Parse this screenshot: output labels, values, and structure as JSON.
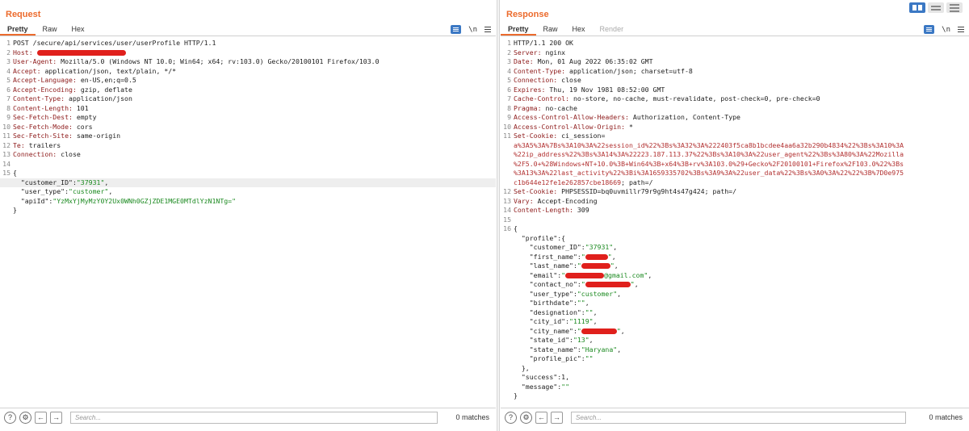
{
  "request": {
    "title": "Request",
    "tabs": [
      "Pretty",
      "Raw",
      "Hex"
    ],
    "newline_toggle": "\\n",
    "search_placeholder": "Search...",
    "matches": "0 matches",
    "lines": [
      {
        "n": "1",
        "parts": [
          {
            "c": "v",
            "t": "POST /secure/api/services/user/userProfile HTTP/1.1"
          }
        ]
      },
      {
        "n": "2",
        "parts": [
          {
            "c": "k",
            "t": "Host: "
          },
          {
            "redact": 110
          }
        ]
      },
      {
        "n": "3",
        "parts": [
          {
            "c": "k",
            "t": "User-Agent: "
          },
          {
            "c": "v",
            "t": "Mozilla/5.0 (Windows NT 10.0; Win64; x64; rv:103.0) Gecko/20100101 Firefox/103.0"
          }
        ]
      },
      {
        "n": "4",
        "parts": [
          {
            "c": "k",
            "t": "Accept: "
          },
          {
            "c": "v",
            "t": "application/json, text/plain, */*"
          }
        ]
      },
      {
        "n": "5",
        "parts": [
          {
            "c": "k",
            "t": "Accept-Language: "
          },
          {
            "c": "v",
            "t": "en-US,en;q=0.5"
          }
        ]
      },
      {
        "n": "6",
        "parts": [
          {
            "c": "k",
            "t": "Accept-Encoding: "
          },
          {
            "c": "v",
            "t": "gzip, deflate"
          }
        ]
      },
      {
        "n": "7",
        "parts": [
          {
            "c": "k",
            "t": "Content-Type: "
          },
          {
            "c": "v",
            "t": "application/json"
          }
        ]
      },
      {
        "n": "8",
        "parts": [
          {
            "c": "k",
            "t": "Content-Length: "
          },
          {
            "c": "v",
            "t": "101"
          }
        ]
      },
      {
        "n": "9",
        "parts": [
          {
            "c": "k",
            "t": "Sec-Fetch-Dest: "
          },
          {
            "c": "v",
            "t": "empty"
          }
        ]
      },
      {
        "n": "10",
        "parts": [
          {
            "c": "k",
            "t": "Sec-Fetch-Mode: "
          },
          {
            "c": "v",
            "t": "cors"
          }
        ]
      },
      {
        "n": "11",
        "parts": [
          {
            "c": "k",
            "t": "Sec-Fetch-Site: "
          },
          {
            "c": "v",
            "t": "same-origin"
          }
        ]
      },
      {
        "n": "12",
        "parts": [
          {
            "c": "k",
            "t": "Te: "
          },
          {
            "c": "v",
            "t": "trailers"
          }
        ]
      },
      {
        "n": "13",
        "parts": [
          {
            "c": "k",
            "t": "Connection: "
          },
          {
            "c": "v",
            "t": "close"
          }
        ]
      },
      {
        "n": "14",
        "parts": []
      },
      {
        "n": "15",
        "parts": [
          {
            "c": "v",
            "t": "{"
          }
        ]
      },
      {
        "n": "",
        "hl": true,
        "parts": [
          {
            "c": "jk",
            "t": "  \"customer_ID\":"
          },
          {
            "c": "js",
            "t": "\"37931\""
          },
          {
            "c": "v",
            "t": ","
          }
        ]
      },
      {
        "n": "",
        "parts": [
          {
            "c": "jk",
            "t": "  \"user_type\":"
          },
          {
            "c": "js",
            "t": "\"customer\""
          },
          {
            "c": "v",
            "t": ","
          }
        ]
      },
      {
        "n": "",
        "parts": [
          {
            "c": "jk",
            "t": "  \"apiId\":"
          },
          {
            "c": "js",
            "t": "\"YzMxYjMyMzY0Y2Ux0WNh0GZjZDE1MGE0MTdlYzN1NTg=\""
          }
        ]
      },
      {
        "n": "",
        "parts": [
          {
            "c": "v",
            "t": "}"
          }
        ]
      }
    ]
  },
  "response": {
    "title": "Response",
    "tabs": [
      "Pretty",
      "Raw",
      "Hex",
      "Render"
    ],
    "newline_toggle": "\\n",
    "search_placeholder": "Search...",
    "matches": "0 matches",
    "lines": [
      {
        "n": "1",
        "parts": [
          {
            "c": "v",
            "t": "HTTP/1.1 200 OK"
          }
        ]
      },
      {
        "n": "2",
        "parts": [
          {
            "c": "k",
            "t": "Server: "
          },
          {
            "c": "v",
            "t": "nginx"
          }
        ]
      },
      {
        "n": "3",
        "parts": [
          {
            "c": "k",
            "t": "Date: "
          },
          {
            "c": "v",
            "t": "Mon, 01 Aug 2022 06:35:02 GMT"
          }
        ]
      },
      {
        "n": "4",
        "parts": [
          {
            "c": "k",
            "t": "Content-Type: "
          },
          {
            "c": "v",
            "t": "application/json; charset=utf-8"
          }
        ]
      },
      {
        "n": "5",
        "parts": [
          {
            "c": "k",
            "t": "Connection: "
          },
          {
            "c": "v",
            "t": "close"
          }
        ]
      },
      {
        "n": "6",
        "parts": [
          {
            "c": "k",
            "t": "Expires: "
          },
          {
            "c": "v",
            "t": "Thu, 19 Nov 1981 08:52:00 GMT"
          }
        ]
      },
      {
        "n": "7",
        "parts": [
          {
            "c": "k",
            "t": "Cache-Control: "
          },
          {
            "c": "v",
            "t": "no-store, no-cache, must-revalidate, post-check=0, pre-check=0"
          }
        ]
      },
      {
        "n": "8",
        "parts": [
          {
            "c": "k",
            "t": "Pragma: "
          },
          {
            "c": "v",
            "t": "no-cache"
          }
        ]
      },
      {
        "n": "9",
        "parts": [
          {
            "c": "k",
            "t": "Access-Control-Allow-Headers: "
          },
          {
            "c": "v",
            "t": "Authorization, Content-Type"
          }
        ]
      },
      {
        "n": "10",
        "parts": [
          {
            "c": "k",
            "t": "Access-Control-Allow-Origin: "
          },
          {
            "c": "v",
            "t": "*"
          }
        ]
      },
      {
        "n": "11",
        "parts": [
          {
            "c": "k",
            "t": "Set-Cookie: "
          },
          {
            "c": "v",
            "t": "ci_session="
          }
        ]
      },
      {
        "n": "",
        "parts": [
          {
            "c": "red",
            "t": "a%3A5%3A%7Bs%3A10%3A%22session_id%22%3Bs%3A32%3A%222403f5ca8b1bcdee4aa6a32b290b4834%22%3Bs%3A10%3A"
          }
        ]
      },
      {
        "n": "",
        "parts": [
          {
            "c": "red",
            "t": "%22ip_address%22%3Bs%3A14%3A%22223.187.113.37%22%3Bs%3A10%3A%22user_agent%22%3Bs%3A80%3A%22Mozilla"
          }
        ]
      },
      {
        "n": "",
        "parts": [
          {
            "c": "red",
            "t": "%2F5.0+%28Windows+NT+10.0%3B+Win64%3B+x64%3B+rv%3A103.0%29+Gecko%2F20100101+Firefox%2F103.0%22%3Bs"
          }
        ]
      },
      {
        "n": "",
        "parts": [
          {
            "c": "red",
            "t": "%3A13%3A%22last_activity%22%3Bi%3A1659335702%3Bs%3A9%3A%22user_data%22%3Bs%3A0%3A%22%22%3B%7D0e975"
          }
        ]
      },
      {
        "n": "",
        "parts": [
          {
            "c": "red",
            "t": "c1b644e12fe1e262857cbe18669"
          },
          {
            "c": "v",
            "t": "; path=/"
          }
        ]
      },
      {
        "n": "12",
        "parts": [
          {
            "c": "k",
            "t": "Set-Cookie: "
          },
          {
            "c": "v",
            "t": "PHPSESSID=bq0uvmillr79r9g9ht4s47g424; path=/"
          }
        ]
      },
      {
        "n": "13",
        "parts": [
          {
            "c": "k",
            "t": "Vary: "
          },
          {
            "c": "v",
            "t": "Accept-Encoding"
          }
        ]
      },
      {
        "n": "14",
        "parts": [
          {
            "c": "k",
            "t": "Content-Length: "
          },
          {
            "c": "v",
            "t": "309"
          }
        ]
      },
      {
        "n": "15",
        "parts": []
      },
      {
        "n": "16",
        "parts": [
          {
            "c": "v",
            "t": "{"
          }
        ]
      },
      {
        "n": "",
        "parts": [
          {
            "c": "jk",
            "t": "  \"profile\":{"
          }
        ]
      },
      {
        "n": "",
        "parts": [
          {
            "c": "jk",
            "t": "    \"customer_ID\":"
          },
          {
            "c": "js",
            "t": "\"37931\""
          },
          {
            "c": "v",
            "t": ","
          }
        ]
      },
      {
        "n": "",
        "parts": [
          {
            "c": "jk",
            "t": "    \"first_name\":"
          },
          {
            "c": "js",
            "t": "\""
          },
          {
            "redact": 28
          },
          {
            "c": "js",
            "t": "\""
          },
          {
            "c": "v",
            "t": ","
          }
        ]
      },
      {
        "n": "",
        "parts": [
          {
            "c": "jk",
            "t": "    \"last_name\":"
          },
          {
            "c": "js",
            "t": "\""
          },
          {
            "redact": 36
          },
          {
            "c": "js",
            "t": "\""
          },
          {
            "c": "v",
            "t": ","
          }
        ]
      },
      {
        "n": "",
        "parts": [
          {
            "c": "jk",
            "t": "    \"email\":"
          },
          {
            "c": "js",
            "t": "\""
          },
          {
            "redact": 48
          },
          {
            "c": "js",
            "t": "@gmail.com\""
          },
          {
            "c": "v",
            "t": ","
          }
        ]
      },
      {
        "n": "",
        "parts": [
          {
            "c": "jk",
            "t": "    \"contact_no\":"
          },
          {
            "c": "js",
            "t": "\""
          },
          {
            "redact": 56
          },
          {
            "c": "js",
            "t": "\""
          },
          {
            "c": "v",
            "t": ","
          }
        ]
      },
      {
        "n": "",
        "parts": [
          {
            "c": "jk",
            "t": "    \"user_type\":"
          },
          {
            "c": "js",
            "t": "\"customer\""
          },
          {
            "c": "v",
            "t": ","
          }
        ]
      },
      {
        "n": "",
        "parts": [
          {
            "c": "jk",
            "t": "    \"birthdate\":"
          },
          {
            "c": "js",
            "t": "\"\""
          },
          {
            "c": "v",
            "t": ","
          }
        ]
      },
      {
        "n": "",
        "parts": [
          {
            "c": "jk",
            "t": "    \"designation\":"
          },
          {
            "c": "js",
            "t": "\"\""
          },
          {
            "c": "v",
            "t": ","
          }
        ]
      },
      {
        "n": "",
        "parts": [
          {
            "c": "jk",
            "t": "    \"city_id\":"
          },
          {
            "c": "js",
            "t": "\"1119\""
          },
          {
            "c": "v",
            "t": ","
          }
        ]
      },
      {
        "n": "",
        "parts": [
          {
            "c": "jk",
            "t": "    \"city_name\":"
          },
          {
            "c": "js",
            "t": "\""
          },
          {
            "redact": 44
          },
          {
            "c": "js",
            "t": "\""
          },
          {
            "c": "v",
            "t": ","
          }
        ]
      },
      {
        "n": "",
        "parts": [
          {
            "c": "jk",
            "t": "    \"state_id\":"
          },
          {
            "c": "js",
            "t": "\"13\""
          },
          {
            "c": "v",
            "t": ","
          }
        ]
      },
      {
        "n": "",
        "parts": [
          {
            "c": "jk",
            "t": "    \"state_name\":"
          },
          {
            "c": "js",
            "t": "\"Haryana\""
          },
          {
            "c": "v",
            "t": ","
          }
        ]
      },
      {
        "n": "",
        "parts": [
          {
            "c": "jk",
            "t": "    \"profile_pic\":"
          },
          {
            "c": "js",
            "t": "\"\""
          }
        ]
      },
      {
        "n": "",
        "parts": [
          {
            "c": "v",
            "t": "  },"
          }
        ]
      },
      {
        "n": "",
        "parts": [
          {
            "c": "jk",
            "t": "  \"success\":"
          },
          {
            "c": "v",
            "t": "1,"
          }
        ]
      },
      {
        "n": "",
        "parts": [
          {
            "c": "jk",
            "t": "  \"message\":"
          },
          {
            "c": "js",
            "t": "\"\""
          }
        ]
      },
      {
        "n": "",
        "parts": [
          {
            "c": "v",
            "t": "}"
          }
        ]
      }
    ]
  },
  "colors": {
    "accent": "#ec6b2d",
    "header_key": "#8e1b1b",
    "json_string": "#1c8a21",
    "cookie_value": "#b23131",
    "redaction": "#e0201c",
    "toolbar_blue": "#3b78c4"
  },
  "icons": {
    "footer": [
      "help-icon",
      "settings-gear-icon",
      "back-arrow-icon",
      "forward-arrow-icon"
    ],
    "layout": [
      "split-horizontal-icon",
      "split-vertical-icon",
      "tabs-layout-icon"
    ]
  }
}
